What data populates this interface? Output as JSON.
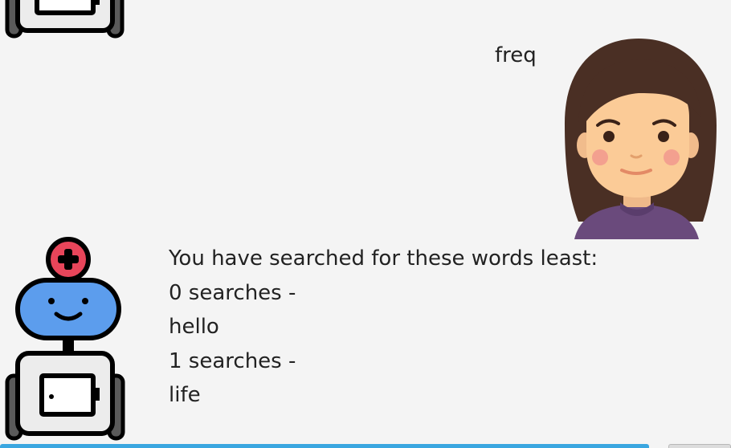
{
  "chat": {
    "user_message": "freq",
    "bot_response": {
      "header": "You have searched for these words least:",
      "lines": [
        "0 searches -",
        "hello",
        "1 searches -",
        "life"
      ]
    }
  },
  "avatars": {
    "bot_icon": "robot-icon",
    "user_icon": "girl-avatar-icon"
  },
  "colors": {
    "background": "#f4f4f4",
    "robot_face": "#5c9ded",
    "robot_antenna": "#e8455a",
    "input_focus": "#3aa6e0"
  }
}
